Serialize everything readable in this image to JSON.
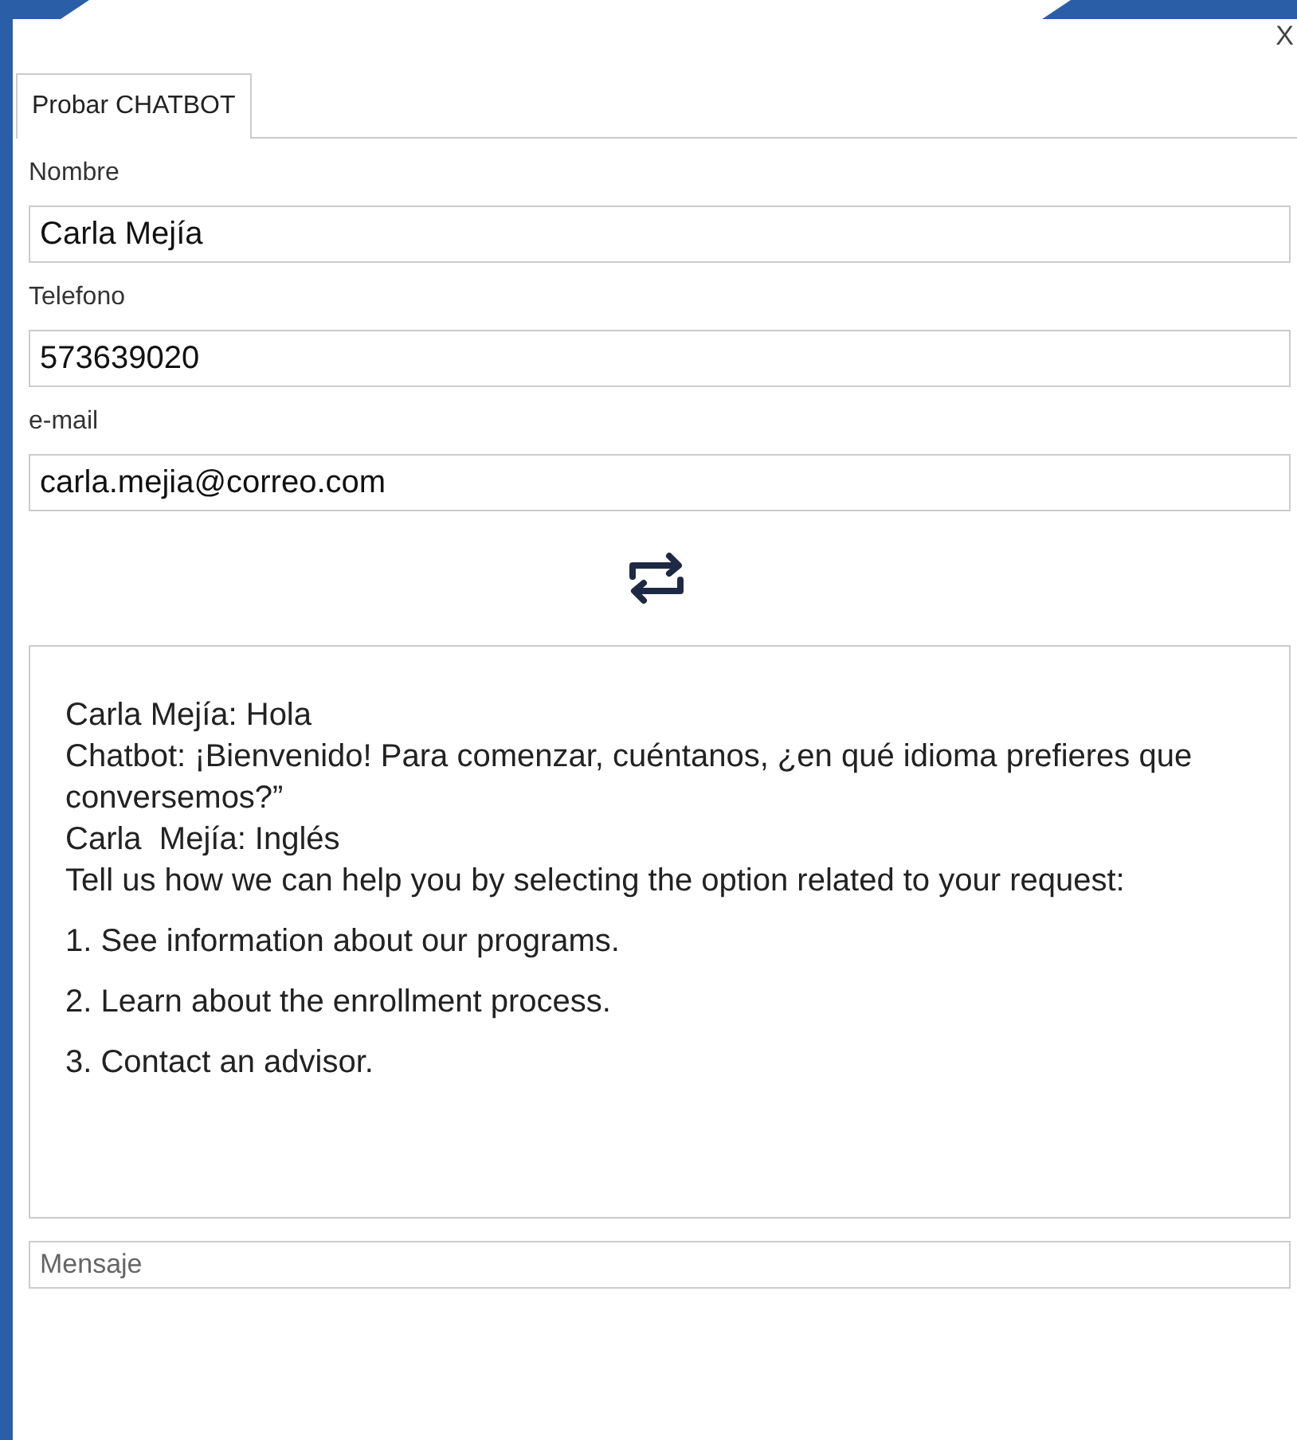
{
  "close_button": "X",
  "tabs": [
    {
      "label": "Probar CHATBOT",
      "selected": true
    }
  ],
  "fields": [
    {
      "label": "Nombre",
      "value": "Carla Mejía"
    },
    {
      "label": "Telefono",
      "value": "573639020"
    },
    {
      "label": "e-mail",
      "value": "carla.mejia@correo.com"
    }
  ],
  "chat": [
    {
      "kind": "line",
      "text": "Carla Mejía: Hola"
    },
    {
      "kind": "line",
      "text": "Chatbot: ¡Bienvenido! Para comenzar, cuéntanos, ¿en qué idioma prefieres que conversemos?”"
    },
    {
      "kind": "line",
      "text": "Carla  Mejía: Inglés"
    },
    {
      "kind": "line",
      "text": "Tell us how we can help you by selecting the option related to your request:"
    },
    {
      "kind": "option",
      "text": "1. See information about our programs."
    },
    {
      "kind": "option",
      "text": "2. Learn about the enrollment process."
    },
    {
      "kind": "option",
      "text": "3. Contact an advisor."
    }
  ],
  "message": {
    "placeholder": "Mensaje"
  }
}
